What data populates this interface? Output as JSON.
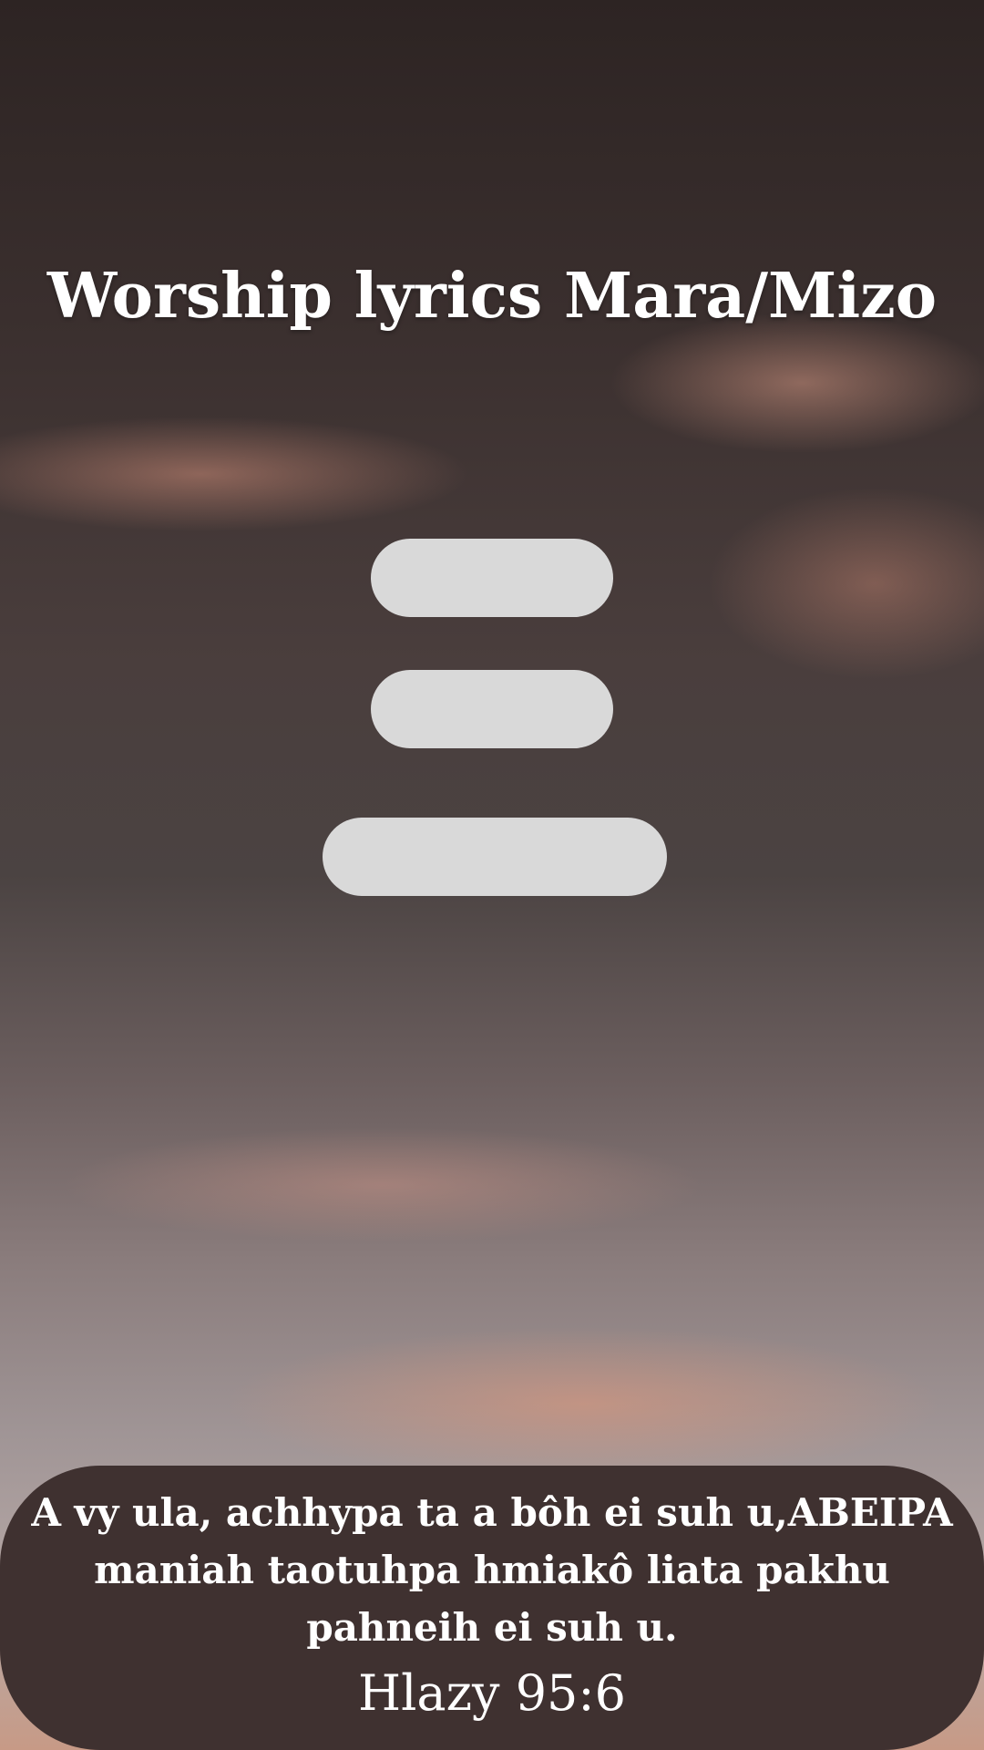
{
  "app": {
    "title": "Worship lyrics Mara/Mizo"
  },
  "menu": {
    "buttons": [
      {
        "label": ""
      },
      {
        "label": ""
      },
      {
        "label": ""
      }
    ]
  },
  "verse": {
    "text": "A vy ula, achhypa ta a bôh ei suh u,ABEIPA maniah taotuhpa hmiakô liata pakhu pahneih ei suh u.",
    "reference": "Hlazy 95:6"
  },
  "colors": {
    "button_bg": "#d9d9d9",
    "verse_box_bg": "#3f3130",
    "text": "#ffffff"
  }
}
